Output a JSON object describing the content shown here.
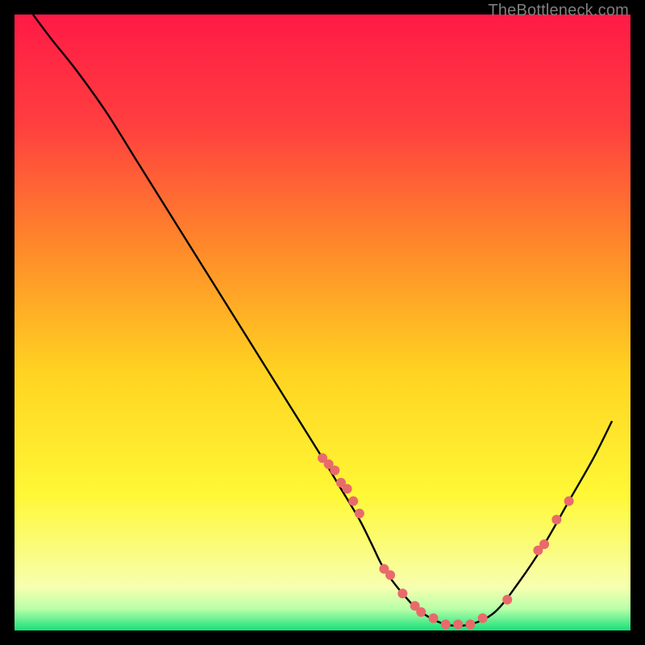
{
  "watermark": "TheBottleneck.com",
  "chart_data": {
    "type": "line",
    "title": "",
    "xlabel": "",
    "ylabel": "",
    "xlim": [
      0,
      100
    ],
    "ylim": [
      0,
      100
    ],
    "gradient_stops": [
      {
        "offset": 0.0,
        "color": "#ff1a46"
      },
      {
        "offset": 0.18,
        "color": "#ff3f3f"
      },
      {
        "offset": 0.38,
        "color": "#ff8a2a"
      },
      {
        "offset": 0.58,
        "color": "#ffd321"
      },
      {
        "offset": 0.78,
        "color": "#fff836"
      },
      {
        "offset": 0.93,
        "color": "#f7ffb0"
      },
      {
        "offset": 0.965,
        "color": "#b8ffa8"
      },
      {
        "offset": 1.0,
        "color": "#16e07a"
      }
    ],
    "series": [
      {
        "name": "curve",
        "type": "line",
        "x": [
          3,
          6,
          10,
          15,
          20,
          25,
          30,
          35,
          40,
          45,
          50,
          53,
          56,
          58,
          60,
          63,
          66,
          70,
          74,
          78,
          82,
          86,
          90,
          94,
          97
        ],
        "y": [
          100,
          96,
          91,
          84,
          76,
          68,
          60,
          52,
          44,
          36,
          28,
          23,
          18,
          14,
          10,
          6,
          3,
          1,
          1,
          3,
          8,
          14,
          21,
          28,
          34
        ]
      },
      {
        "name": "marker-cluster",
        "type": "scatter",
        "color": "#e96a6a",
        "x": [
          50,
          51,
          52,
          53,
          54,
          55,
          56,
          60,
          61,
          63,
          65,
          66,
          68,
          70,
          72,
          74,
          76,
          80,
          85,
          86,
          88,
          90
        ],
        "y": [
          28,
          27,
          26,
          24,
          23,
          21,
          19,
          10,
          9,
          6,
          4,
          3,
          2,
          1,
          1,
          1,
          2,
          5,
          13,
          14,
          18,
          21
        ]
      }
    ]
  }
}
